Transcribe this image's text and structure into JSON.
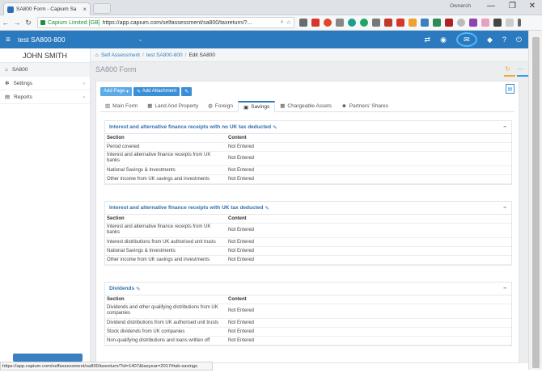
{
  "browser": {
    "tab_title": "SA800 Form - Capium Sa",
    "tab_close": "×",
    "user_label": "Ownersh",
    "win_minimize": "—",
    "win_maximize": "❐",
    "win_close": "✕",
    "secure_label": "Capium Limited [GB]",
    "url": "https://app.capium.com/selfassessment/sa800/taxreturn/?...",
    "status_url": "https://app.capium.com/selfassessment/sa800/taxreturn/?id=1407&taxyear=2017#tab-savings"
  },
  "app": {
    "title": "test SA800-800",
    "colors": {
      "primary": "#2b79be",
      "accent": "#2f80c3",
      "orange": "#f2a93b"
    }
  },
  "sidebar": {
    "user_name": "JOHN SMITH",
    "items": [
      {
        "label": "SA800",
        "icon": "home-icon"
      },
      {
        "label": "Settings",
        "icon": "gear-icon"
      },
      {
        "label": "Reports",
        "icon": "file-icon"
      }
    ]
  },
  "breadcrumb": {
    "items": [
      "Self Assessment",
      "test SA800-800",
      "Edit SA800"
    ],
    "sep": "/"
  },
  "page": {
    "title": "SA800 Form"
  },
  "toolbar": {
    "add_page": "Add Page",
    "add_attachment": "Add Attachment"
  },
  "tabs": [
    {
      "label": "Main Form",
      "icon": "chart-icon"
    },
    {
      "label": "Land And Property",
      "icon": "building-icon"
    },
    {
      "label": "Foreign",
      "icon": "globe-icon"
    },
    {
      "label": "Savings",
      "icon": "bank-icon",
      "active": true
    },
    {
      "label": "Chargeable Assets",
      "icon": "building-icon"
    },
    {
      "label": "Partners' Shares",
      "icon": "users-icon"
    }
  ],
  "table_headers": {
    "section": "Section",
    "content": "Content"
  },
  "panels": [
    {
      "title": "Interest and alternative finance receipts with no UK tax deducted",
      "rows": [
        {
          "section": "Period covered",
          "content": "Not Entered"
        },
        {
          "section": "Interest and alternative finance receipts from UK banks",
          "content": "Not Entered"
        },
        {
          "section": "National Savings & Investments",
          "content": "Not Entered"
        },
        {
          "section": "Other income from UK savings and investments",
          "content": "Not Entered"
        }
      ]
    },
    {
      "title": "Interest and alternative finance receipts with UK tax deducted",
      "rows": [
        {
          "section": "Interest and alternative finance receipts from UK banks",
          "content": "Not Entered"
        },
        {
          "section": "Interest distributions from UK authorised unit trusts",
          "content": "Not Entered"
        },
        {
          "section": "National Savings & Investments",
          "content": "Not Entered"
        },
        {
          "section": "Other income from UK savings and investments",
          "content": "Not Entered"
        }
      ]
    },
    {
      "title": "Dividends",
      "rows": [
        {
          "section": "Dividends and other qualifying distributions from UK companies",
          "content": "Not Entered"
        },
        {
          "section": "Dividend distributions from UK authorised unit trusts",
          "content": "Not Entered"
        },
        {
          "section": "Stock dividends from UK companies",
          "content": "Not Entered"
        },
        {
          "section": "Non-qualifying distributions and loans written off",
          "content": "Not Entered"
        }
      ]
    }
  ]
}
